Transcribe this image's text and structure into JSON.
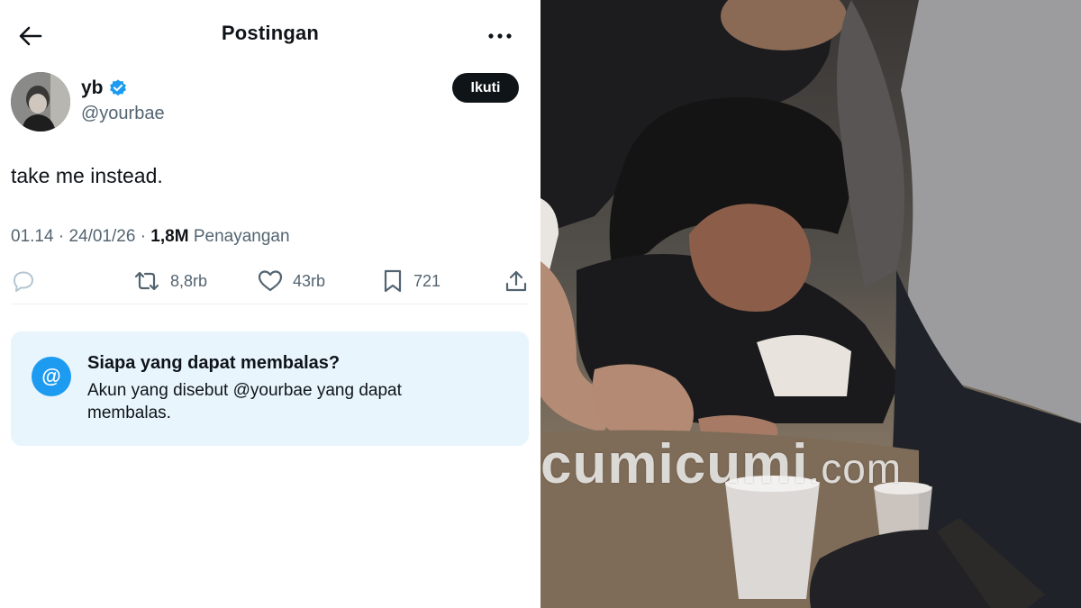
{
  "header": {
    "title": "Postingan",
    "back_icon": "arrow-left-icon",
    "more_icon": "more-horizontal-icon"
  },
  "author": {
    "display_name": "yb",
    "handle": "@yourbae",
    "verified": true,
    "follow_label": "Ikuti"
  },
  "post": {
    "text": "take me instead.",
    "time": "01.14",
    "date": "24/01/26",
    "views_count": "1,8M",
    "views_label": "Penayangan"
  },
  "stats": {
    "reposts": "8,8rb",
    "likes": "43rb",
    "bookmarks": "721"
  },
  "reply_restriction": {
    "title": "Siapa yang dapat membalas?",
    "description": "Akun yang disebut @yourbae yang dapat membalas."
  },
  "photo": {
    "watermark_main": "cumicumi",
    "watermark_suffix": ".com"
  },
  "colors": {
    "accent": "#1d9bf0",
    "text": "#0f1419",
    "muted": "#536471",
    "card_bg": "#e8f5fd"
  }
}
